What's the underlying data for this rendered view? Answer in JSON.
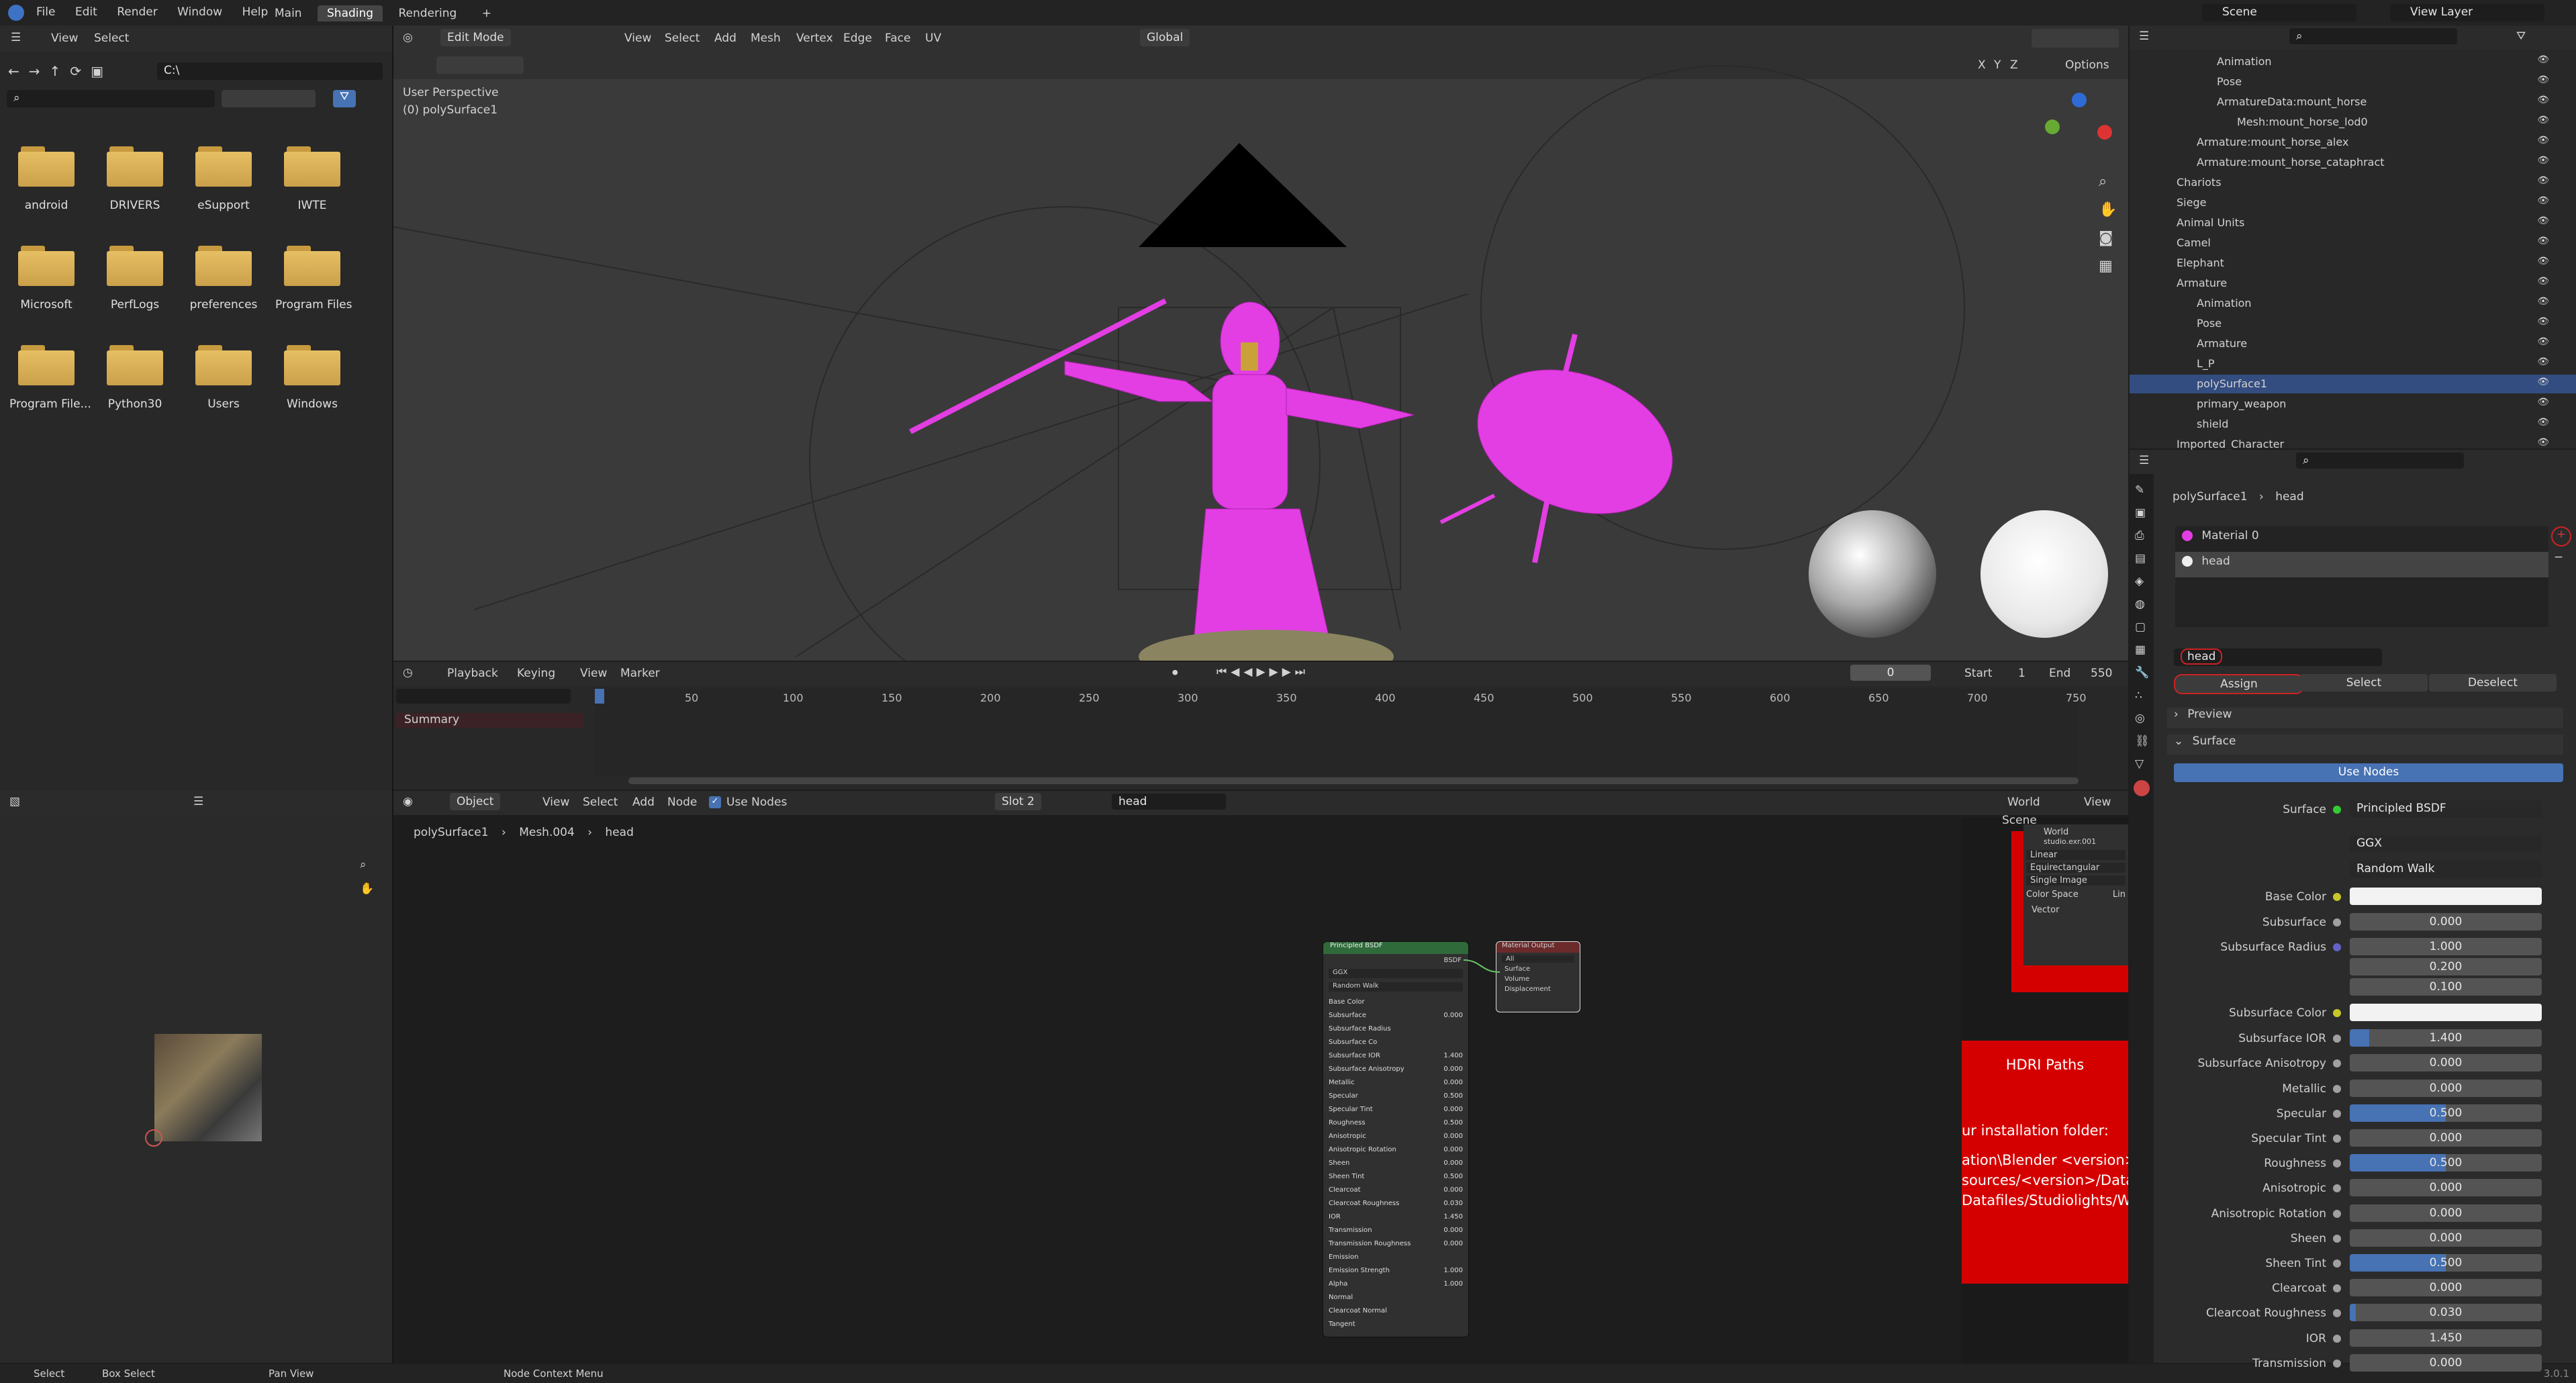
{
  "topbar": {
    "menus": [
      "File",
      "Edit",
      "Render",
      "Window",
      "Help"
    ],
    "workspaces": [
      "Main",
      "Shading",
      "Rendering"
    ],
    "active_workspace": "Shading",
    "add_tab": "+",
    "scene_label": "Scene",
    "view_layer_label": "View Layer"
  },
  "file_browser": {
    "menus": [
      "View",
      "Select"
    ],
    "path": "C:\\",
    "items": [
      "android",
      "DRIVERS",
      "eSupport",
      "IWTE",
      "Microsoft",
      "PerfLogs",
      "preferences",
      "Program Files",
      "Program File...",
      "Python30",
      "Users",
      "Windows"
    ]
  },
  "viewport": {
    "mode": "Edit Mode",
    "menus": [
      "View",
      "Select",
      "Add",
      "Mesh",
      "Vertex",
      "Edge",
      "Face",
      "UV"
    ],
    "orientation": "Global",
    "perspective_label": "User Perspective",
    "object_label": "(0) polySurface1",
    "options_label": "Options",
    "axis_labels": [
      "X",
      "Y",
      "Z"
    ]
  },
  "timeline": {
    "menus": [
      "Playback",
      "Keying",
      "View",
      "Marker"
    ],
    "current_frame": "0",
    "start_label": "Start",
    "start": "1",
    "end_label": "End",
    "end": "550",
    "summary_label": "Summary",
    "ticks": [
      "0",
      "50",
      "100",
      "150",
      "200",
      "250",
      "300",
      "350",
      "400",
      "450",
      "500",
      "550",
      "600",
      "650",
      "700",
      "750"
    ]
  },
  "node_editor": {
    "mode": "Object",
    "menus": [
      "View",
      "Select",
      "Add",
      "Node"
    ],
    "use_nodes_label": "Use Nodes",
    "slot": "Slot 2",
    "material": "head",
    "breadcrumb": [
      "polySurface1",
      "Mesh.004",
      "head"
    ],
    "world_label": "World",
    "view_label": "View",
    "scene_label": "Scene",
    "world_name": "World",
    "world_image": "studio.exr.001",
    "world_options": [
      "Linear",
      "Equirectangular",
      "Single Image"
    ],
    "world_color_space": "Color Space",
    "world_color_space_value": "Lin",
    "world_vector": "Vector",
    "hdri_title": "HDRI Paths",
    "hdri_lines": [
      "ur installation folder:",
      "ation\\Blender <version>\\<v",
      "sources/<version>/Datafile",
      "Datafiles/Studiolights/Worl"
    ],
    "principled": {
      "title": "Principled BSDF",
      "output": "BSDF",
      "dist": "GGX",
      "sss": "Random Walk",
      "rows": [
        {
          "label": "Base Color",
          "value": ""
        },
        {
          "label": "Subsurface",
          "value": "0.000"
        },
        {
          "label": "Subsurface Radius",
          "value": ""
        },
        {
          "label": "Subsurface Co",
          "value": ""
        },
        {
          "label": "Subsurface IOR",
          "value": "1.400"
        },
        {
          "label": "Subsurface Anisotropy",
          "value": "0.000"
        },
        {
          "label": "Metallic",
          "value": "0.000"
        },
        {
          "label": "Specular",
          "value": "0.500"
        },
        {
          "label": "Specular Tint",
          "value": "0.000"
        },
        {
          "label": "Roughness",
          "value": "0.500"
        },
        {
          "label": "Anisotropic",
          "value": "0.000"
        },
        {
          "label": "Anisotropic Rotation",
          "value": "0.000"
        },
        {
          "label": "Sheen",
          "value": "0.000"
        },
        {
          "label": "Sheen Tint",
          "value": "0.500"
        },
        {
          "label": "Clearcoat",
          "value": "0.000"
        },
        {
          "label": "Clearcoat Roughness",
          "value": "0.030"
        },
        {
          "label": "IOR",
          "value": "1.450"
        },
        {
          "label": "Transmission",
          "value": "0.000"
        },
        {
          "label": "Transmission Roughness",
          "value": "0.000"
        },
        {
          "label": "Emission",
          "value": ""
        },
        {
          "label": "Emission Strength",
          "value": "1.000"
        },
        {
          "label": "Alpha",
          "value": "1.000"
        },
        {
          "label": "Normal",
          "value": ""
        },
        {
          "label": "Clearcoat Normal",
          "value": ""
        },
        {
          "label": "Tangent",
          "value": ""
        }
      ]
    },
    "output_node": {
      "title": "Material Output",
      "target": "All",
      "sockets": [
        "Surface",
        "Volume",
        "Displacement"
      ]
    }
  },
  "outliner": {
    "items": [
      {
        "label": "Animation",
        "indent": 2
      },
      {
        "label": "Pose",
        "indent": 2
      },
      {
        "label": "ArmatureData:mount_horse",
        "indent": 2
      },
      {
        "label": "Mesh:mount_horse_lod0",
        "indent": 3
      },
      {
        "label": "Armature:mount_horse_alex",
        "indent": 1
      },
      {
        "label": "Armature:mount_horse_cataphract",
        "indent": 1
      },
      {
        "label": "Chariots",
        "indent": 0
      },
      {
        "label": "Siege",
        "indent": 0
      },
      {
        "label": "Animal Units",
        "indent": 0
      },
      {
        "label": "Camel",
        "indent": 0
      },
      {
        "label": "Elephant",
        "indent": 0
      },
      {
        "label": "Armature",
        "indent": 0
      },
      {
        "label": "Animation",
        "indent": 1
      },
      {
        "label": "Pose",
        "indent": 1
      },
      {
        "label": "Armature",
        "indent": 1
      },
      {
        "label": "L_P",
        "indent": 1
      },
      {
        "label": "polySurface1",
        "indent": 1
      },
      {
        "label": "primary_weapon",
        "indent": 1
      },
      {
        "label": "shield",
        "indent": 1
      },
      {
        "label": "Imported_Character",
        "indent": 0
      }
    ],
    "selected": "polySurface1"
  },
  "properties": {
    "breadcrumb": [
      "polySurface1",
      "head"
    ],
    "slots": [
      "Material 0",
      "head"
    ],
    "material_name": "head",
    "assign": "Assign",
    "select": "Select",
    "deselect": "Deselect",
    "preview": "Preview",
    "surface_panel": "Surface",
    "use_nodes": "Use Nodes",
    "surface_label": "Surface",
    "surface_value": "Principled BSDF",
    "distribution": "GGX",
    "subsurface_method": "Random Walk",
    "rows": [
      {
        "label": "Base Color",
        "kind": "color",
        "value": ""
      },
      {
        "label": "Subsurface",
        "kind": "num",
        "value": "0.000",
        "fill": 0
      },
      {
        "label": "Subsurface Radius",
        "kind": "vec",
        "values": [
          "1.000",
          "0.200",
          "0.100"
        ]
      },
      {
        "label": "Subsurface Color",
        "kind": "color",
        "value": ""
      },
      {
        "label": "Subsurface IOR",
        "kind": "num",
        "value": "1.400",
        "fill": 0.1
      },
      {
        "label": "Subsurface Anisotropy",
        "kind": "num",
        "value": "0.000",
        "fill": 0
      },
      {
        "label": "Metallic",
        "kind": "num",
        "value": "0.000",
        "fill": 0
      },
      {
        "label": "Specular",
        "kind": "num",
        "value": "0.500",
        "fill": 0.5
      },
      {
        "label": "Specular Tint",
        "kind": "num",
        "value": "0.000",
        "fill": 0
      },
      {
        "label": "Roughness",
        "kind": "num",
        "value": "0.500",
        "fill": 0.5
      },
      {
        "label": "Anisotropic",
        "kind": "num",
        "value": "0.000",
        "fill": 0
      },
      {
        "label": "Anisotropic Rotation",
        "kind": "num",
        "value": "0.000",
        "fill": 0
      },
      {
        "label": "Sheen",
        "kind": "num",
        "value": "0.000",
        "fill": 0
      },
      {
        "label": "Sheen Tint",
        "kind": "num",
        "value": "0.500",
        "fill": 0.5
      },
      {
        "label": "Clearcoat",
        "kind": "num",
        "value": "0.000",
        "fill": 0
      },
      {
        "label": "Clearcoat Roughness",
        "kind": "num",
        "value": "0.030",
        "fill": 0.03
      },
      {
        "label": "IOR",
        "kind": "num",
        "value": "1.450",
        "fill": 0
      },
      {
        "label": "Transmission",
        "kind": "num",
        "value": "0.000",
        "fill": 0
      }
    ]
  },
  "statusbar": {
    "items": [
      "Select",
      "Box Select",
      "Pan View",
      "Node Context Menu"
    ],
    "version": "3.0.1"
  },
  "colors": {
    "accent": "#4772b3",
    "mesh_selected": "#e23ee3",
    "hdri_red": "#d40000"
  }
}
